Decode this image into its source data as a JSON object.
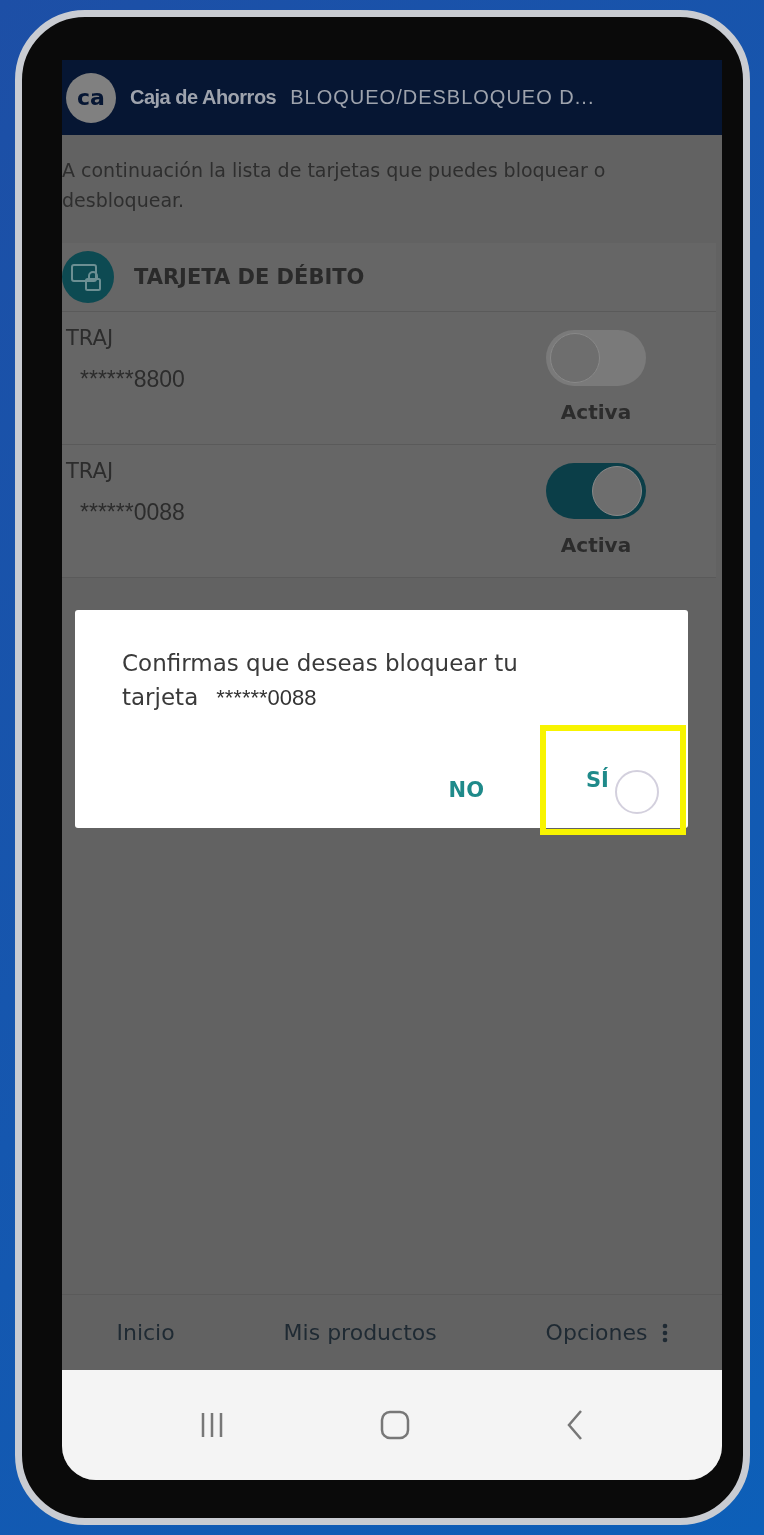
{
  "header": {
    "logo": "ca",
    "brand": "Caja de Ahorros",
    "title": "BLOQUEO/DESBLOQUEO D..."
  },
  "intro": "A continuación la lista de tarjetas que puedes bloquear o desbloquear.",
  "section": {
    "title": "TARJETA DE DÉBITO"
  },
  "cards": [
    {
      "name": "TRAJ",
      "number": "******8800",
      "on": false,
      "status": "Activa"
    },
    {
      "name": "TRAJ",
      "number": "******0088",
      "on": true,
      "status": "Activa"
    }
  ],
  "dialog": {
    "message": "Confirmas que deseas bloquear tu tarjeta",
    "number": "******0088",
    "buttons": [
      {
        "label": "NO",
        "highlighted": false
      },
      {
        "label": "SÍ",
        "highlighted": true
      }
    ]
  },
  "bottom_nav": [
    {
      "label": "Inicio",
      "kind": "plain"
    },
    {
      "label": "Mis productos",
      "kind": "plain"
    },
    {
      "label": "Opciones",
      "kind": "menu"
    }
  ]
}
